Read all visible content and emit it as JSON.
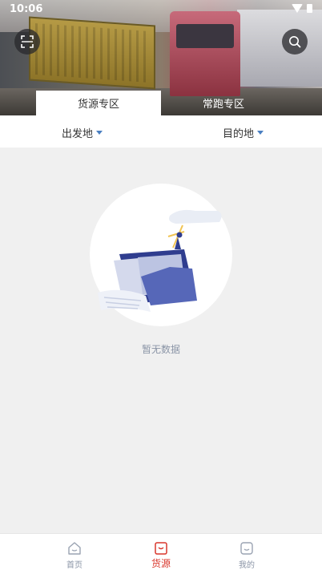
{
  "status_bar": {
    "time": "10:06"
  },
  "header": {
    "scan_icon": "scan-icon",
    "search_icon": "search-icon",
    "tabs": [
      {
        "label": "货源专区",
        "active": true
      },
      {
        "label": "常跑专区",
        "active": false
      }
    ]
  },
  "filters": {
    "origin_label": "出发地",
    "destination_label": "目的地"
  },
  "empty_state": {
    "message": "暂无数据",
    "illustration": "empty-folder-illustration"
  },
  "bottom_nav": {
    "items": [
      {
        "label": "首页",
        "icon": "home-icon",
        "active": false
      },
      {
        "label": "货源",
        "icon": "goods-icon",
        "active": true
      },
      {
        "label": "我的",
        "icon": "profile-icon",
        "active": false
      }
    ]
  },
  "colors": {
    "accent_active": "#d9362b",
    "caret": "#4a7fc1",
    "muted_text": "#8a94a6",
    "page_bg": "#f0f0f0"
  }
}
